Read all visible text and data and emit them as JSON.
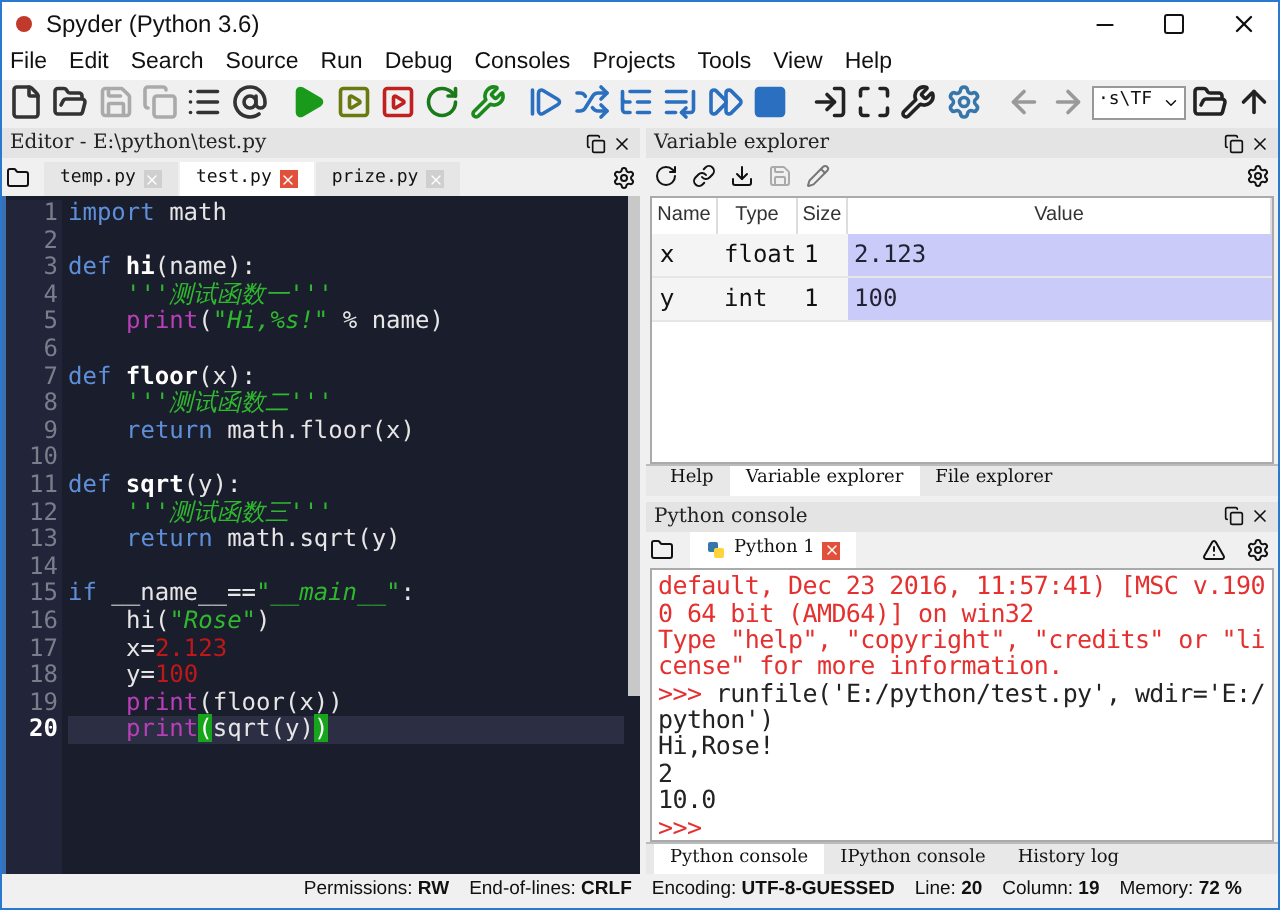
{
  "window": {
    "title": "Spyder (Python 3.6)"
  },
  "menu": [
    "File",
    "Edit",
    "Search",
    "Source",
    "Run",
    "Debug",
    "Consoles",
    "Projects",
    "Tools",
    "View",
    "Help"
  ],
  "toolbar": {
    "path": "·s\\TF"
  },
  "editor": {
    "title": "Editor - E:\\python\\test.py",
    "tabs": [
      {
        "label": "temp.py",
        "selected": false
      },
      {
        "label": "test.py",
        "selected": true
      },
      {
        "label": "prize.py",
        "selected": false
      }
    ],
    "lines": [
      {
        "number": "1",
        "current": false,
        "indent": false,
        "tokens": [
          {
            "kind": "keyword",
            "text": "import"
          },
          {
            "kind": "plain",
            "text": " math"
          }
        ]
      },
      {
        "number": "2",
        "current": false
      },
      {
        "number": "3",
        "current": false,
        "indent": false,
        "tokens": [
          {
            "kind": "keyword",
            "text": "def "
          },
          {
            "kind": "defname",
            "text": "hi"
          },
          {
            "kind": "plain",
            "text": "(name):"
          }
        ]
      },
      {
        "number": "4",
        "current": false,
        "indent": true,
        "tokens": [
          {
            "kind": "string",
            "text": "'''测试函数一'''"
          }
        ]
      },
      {
        "number": "5",
        "current": false,
        "indent": true,
        "tokens": [
          {
            "kind": "builtin",
            "text": "print"
          },
          {
            "kind": "plain",
            "text": "("
          },
          {
            "kind": "string",
            "text": "\"Hi,%s!\""
          },
          {
            "kind": "plain",
            "text": " % name)"
          }
        ]
      },
      {
        "number": "6",
        "current": false
      },
      {
        "number": "7",
        "current": false,
        "indent": false,
        "tokens": [
          {
            "kind": "keyword",
            "text": "def "
          },
          {
            "kind": "defname",
            "text": "floor"
          },
          {
            "kind": "plain",
            "text": "(x):"
          }
        ]
      },
      {
        "number": "8",
        "current": false,
        "indent": true,
        "tokens": [
          {
            "kind": "string",
            "text": "'''测试函数二'''"
          }
        ]
      },
      {
        "number": "9",
        "current": false,
        "indent": true,
        "tokens": [
          {
            "kind": "keyword",
            "text": "return"
          },
          {
            "kind": "plain",
            "text": " math.floor(x)"
          }
        ]
      },
      {
        "number": "10",
        "current": false
      },
      {
        "number": "11",
        "current": false,
        "indent": false,
        "tokens": [
          {
            "kind": "keyword",
            "text": "def "
          },
          {
            "kind": "defname",
            "text": "sqrt"
          },
          {
            "kind": "plain",
            "text": "(y):"
          }
        ]
      },
      {
        "number": "12",
        "current": false,
        "indent": true,
        "tokens": [
          {
            "kind": "string",
            "text": "'''测试函数三'''"
          }
        ]
      },
      {
        "number": "13",
        "current": false,
        "indent": true,
        "tokens": [
          {
            "kind": "keyword",
            "text": "return"
          },
          {
            "kind": "plain",
            "text": " math.sqrt(y)"
          }
        ]
      },
      {
        "number": "14",
        "current": false
      },
      {
        "number": "15",
        "current": false,
        "indent": false,
        "tokens": [
          {
            "kind": "keyword",
            "text": "if"
          },
          {
            "kind": "plain",
            "text": " __name__=="
          },
          {
            "kind": "string",
            "text": "\"__main__\""
          },
          {
            "kind": "plain",
            "text": ":"
          }
        ]
      },
      {
        "number": "16",
        "current": false,
        "indent": true,
        "tokens": [
          {
            "kind": "plain",
            "text": "hi("
          },
          {
            "kind": "string",
            "text": "\"Rose\""
          },
          {
            "kind": "plain",
            "text": ")"
          }
        ]
      },
      {
        "number": "17",
        "current": false,
        "indent": true,
        "tokens": [
          {
            "kind": "plain",
            "text": "x="
          },
          {
            "kind": "number",
            "text": "2.123"
          }
        ]
      },
      {
        "number": "18",
        "current": false,
        "indent": true,
        "tokens": [
          {
            "kind": "plain",
            "text": "y="
          },
          {
            "kind": "number",
            "text": "100"
          }
        ]
      },
      {
        "number": "19",
        "current": false,
        "indent": true,
        "tokens": [
          {
            "kind": "builtin",
            "text": "print"
          },
          {
            "kind": "plain",
            "text": "(floor(x))"
          }
        ]
      },
      {
        "number": "20",
        "current": true,
        "indent": true,
        "tokens": [
          {
            "kind": "builtin",
            "text": "print"
          },
          {
            "kind": "match",
            "text": "("
          },
          {
            "kind": "plain",
            "text": "sqrt(y)"
          },
          {
            "kind": "match",
            "text": ")"
          }
        ]
      }
    ]
  },
  "variable_explorer": {
    "title": "Variable explorer",
    "columns": [
      "Name",
      "Type",
      "Size",
      "Value"
    ],
    "rows": [
      {
        "name": "x",
        "type": "float",
        "size": "1",
        "value": "2.123",
        "color": "#cbcbfa"
      },
      {
        "name": "y",
        "type": "int",
        "size": "1",
        "value": "100",
        "color": "#cbcbfa"
      }
    ],
    "tabs": [
      {
        "label": "Help",
        "selected": false
      },
      {
        "label": "Variable explorer",
        "selected": true
      },
      {
        "label": "File explorer",
        "selected": false
      }
    ]
  },
  "console": {
    "title": "Python console",
    "tab": "Python 1",
    "lines": [
      {
        "kind": "error",
        "text": "default, Dec 23 2016, 11:57:41) [MSC v.190"
      },
      {
        "kind": "error",
        "text": "0 64 bit (AMD64)] on win32"
      },
      {
        "kind": "error",
        "text": "Type \"help\", \"copyright\", \"credits\" or \"li"
      },
      {
        "kind": "error",
        "text": "cense\" for more information."
      },
      {
        "kind": "prompt",
        "prompt": ">>>",
        "text": " runfile('E:/python/test.py', wdir='E:/"
      },
      {
        "kind": "output",
        "text": "python')"
      },
      {
        "kind": "output",
        "text": "Hi,Rose!"
      },
      {
        "kind": "output",
        "text": "2"
      },
      {
        "kind": "output",
        "text": "10.0"
      },
      {
        "kind": "prompt",
        "prompt": ">>>"
      }
    ],
    "tabs": [
      {
        "label": "Python console",
        "selected": true
      },
      {
        "label": "IPython console",
        "selected": false
      },
      {
        "label": "History log",
        "selected": false
      }
    ]
  },
  "status_bar": [
    "Permissions: **RW**",
    "End-of-lines: **CRLF**",
    "Encoding: **UTF-8-GUESSED**",
    "Line: **20**",
    "Column: **19**",
    "Memory: **72 %**"
  ]
}
